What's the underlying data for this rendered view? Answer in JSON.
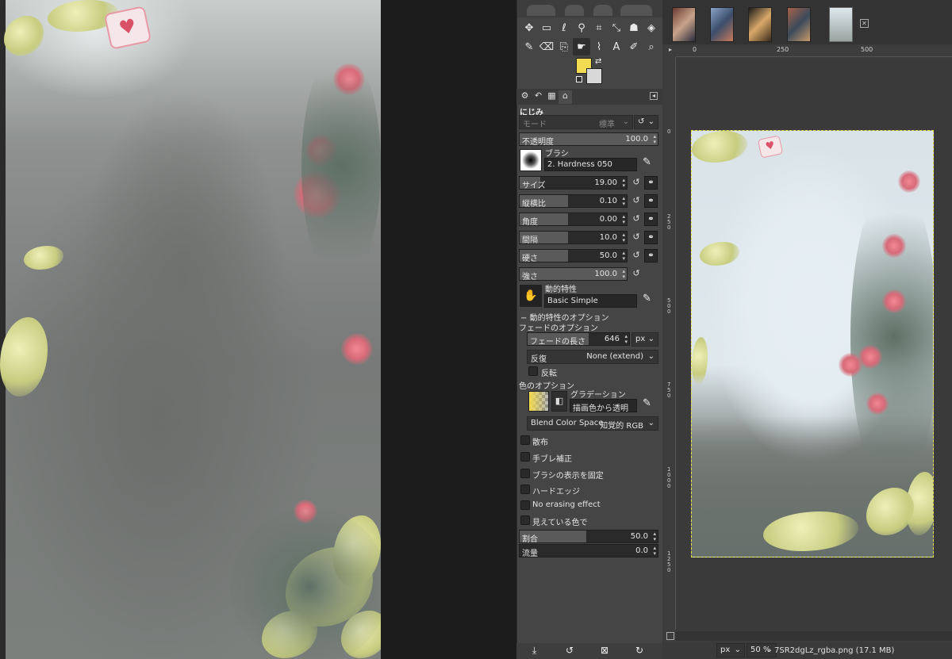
{
  "tool_options": {
    "tool_name": "にじみ",
    "mode_label": "モード",
    "mode_value": "標準",
    "opacity": {
      "label": "不透明度",
      "value": "100.0"
    },
    "brush": {
      "label": "ブラシ",
      "value": "2. Hardness 050"
    },
    "size": {
      "label": "サイズ",
      "value": "19.00",
      "fraction": 0.19
    },
    "aspect": {
      "label": "縦横比",
      "value": "0.10",
      "fraction": 0.38
    },
    "angle": {
      "label": "角度",
      "value": "0.00",
      "fraction": 0.38
    },
    "spacing": {
      "label": "間隔",
      "value": "10.0",
      "fraction": 0.38
    },
    "hardness": {
      "label": "硬さ",
      "value": "50.0",
      "fraction": 0.38
    },
    "force": {
      "label": "強さ",
      "value": "100.0",
      "fraction": 1.0
    },
    "dynamics": {
      "label": "動的特性",
      "value": "Basic Simple"
    },
    "dynamics_options": {
      "label": "動的特性のオプション",
      "toggle": "−"
    },
    "fade_options": {
      "label": "フェードのオプション",
      "fade_length_label": "フェードの長さ",
      "fade_length_value": "646",
      "unit": "px",
      "repeat_label": "反復",
      "repeat_value": "None (extend)",
      "reverse_label": "反転"
    },
    "color_options": {
      "label": "色のオプション",
      "gradient_label": "グラデーション",
      "gradient_value": "描画色から透明",
      "blend_space_label": "Blend Color Space",
      "blend_space_value": "知覚的 RGB"
    },
    "checkboxes": [
      "散布",
      "手ブレ補正",
      "ブラシの表示を固定",
      "ハードエッジ",
      "No erasing effect",
      "見えている色で"
    ],
    "rate": {
      "label": "割合",
      "value": "50.0",
      "fraction": 0.5
    },
    "flow": {
      "label": "流量",
      "value": "0.0",
      "fraction": 0.0
    }
  },
  "colors": {
    "foreground": "#f3dc51",
    "background": "#d8d8d8",
    "accent_border": "#e8e24a"
  },
  "image_window": {
    "ruler_h": [
      "0",
      "250",
      "500"
    ],
    "ruler_v": [
      "0",
      "250",
      "500",
      "750",
      "1000",
      "1250"
    ],
    "unit": "px",
    "zoom": "50 %",
    "status": "7SR2dgLz_rgba.png (17.1 MB)"
  },
  "tools": [
    {
      "icon": "move-icon",
      "glyph": "✥"
    },
    {
      "icon": "rect-select-icon",
      "glyph": "▭"
    },
    {
      "icon": "lasso-icon",
      "glyph": "ℓ"
    },
    {
      "icon": "fuzzy-select-icon",
      "glyph": "⚲"
    },
    {
      "icon": "crop-icon",
      "glyph": "⌗"
    },
    {
      "icon": "unified-transform-icon",
      "glyph": "⤡"
    },
    {
      "icon": "warp-icon",
      "glyph": "☗"
    },
    {
      "icon": "bucket-fill-icon",
      "glyph": "◈"
    },
    {
      "icon": "paintbrush-icon",
      "glyph": "✎"
    },
    {
      "icon": "eraser-icon",
      "glyph": "⌫"
    },
    {
      "icon": "clone-icon",
      "glyph": "⎘"
    },
    {
      "icon": "smudge-icon",
      "glyph": "☛"
    },
    {
      "icon": "paths-icon",
      "glyph": "⌇"
    },
    {
      "icon": "text-icon",
      "glyph": "A"
    },
    {
      "icon": "color-picker-icon",
      "glyph": "✐"
    },
    {
      "icon": "zoom-icon",
      "glyph": "⌕"
    }
  ]
}
